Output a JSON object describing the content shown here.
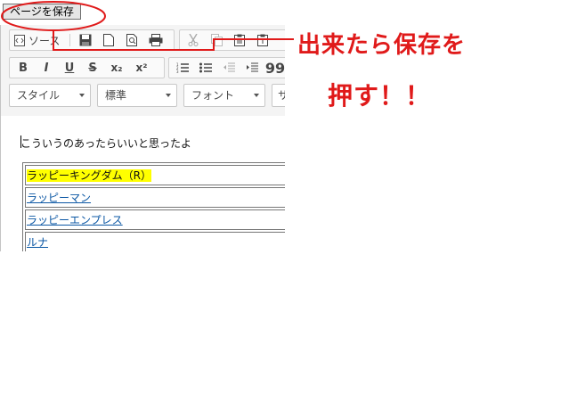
{
  "save_page_button": "ページを保存",
  "toolbar": {
    "source_label": "ソース",
    "buttons": {
      "save": "save-icon",
      "new_page": "new-page-icon",
      "preview": "preview-icon",
      "print": "print-icon",
      "cut": "cut-icon",
      "copy": "copy-icon",
      "paste": "paste-icon",
      "paste_text": "paste-text-icon"
    },
    "format": {
      "bold": "B",
      "italic": "I",
      "underline": "U",
      "strike": "S",
      "subscript": "x₂",
      "superscript": "x²"
    },
    "lists": [
      "numbered-list-icon",
      "bulleted-list-icon",
      "outdent-icon",
      "indent-icon",
      "blockquote-icon"
    ],
    "blockquote_glyph": "99",
    "combos": {
      "style": "スタイル",
      "format": "標準",
      "font": "フォント",
      "size_partial": "サ"
    }
  },
  "content": {
    "paragraph": "こういうのあったらいいと思ったよ",
    "rows": [
      {
        "text": "ラッピーキングダム（R）",
        "highlight": true,
        "link": false
      },
      {
        "text": "ラッピーマン",
        "highlight": false,
        "link": true
      },
      {
        "text": "ラッピーエンプレス",
        "highlight": false,
        "link": true
      },
      {
        "text": "ルナ",
        "highlight": false,
        "link": true
      }
    ]
  },
  "annotation": {
    "line1": "出来たら保存を",
    "line2": "押す！！",
    "color": "#e01a1a"
  }
}
